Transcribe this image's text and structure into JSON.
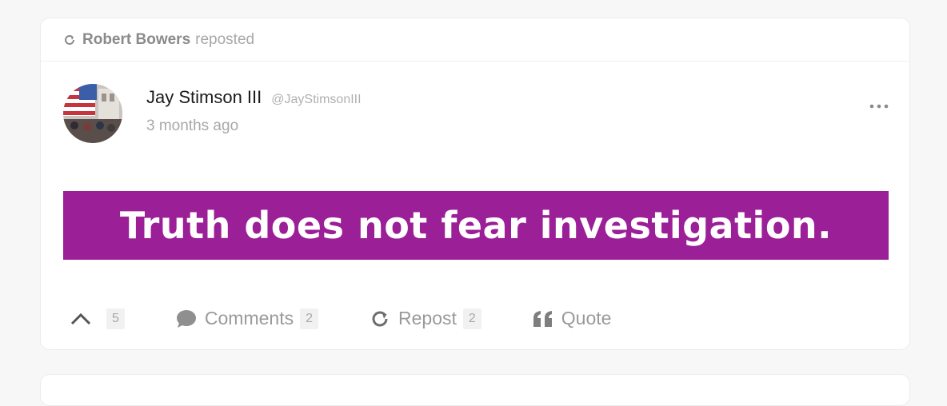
{
  "repost": {
    "user": "Robert Bowers",
    "verb": "reposted"
  },
  "post": {
    "author_name": "Jay Stimson III",
    "author_handle": "@JayStimsonIII",
    "timestamp": "3 months ago",
    "banner_text": "Truth does not fear investigation.",
    "banner_color": "#9b1f97"
  },
  "actions": {
    "upvote_count": "5",
    "comments_label": "Comments",
    "comments_count": "2",
    "repost_label": "Repost",
    "repost_count": "2",
    "quote_label": "Quote"
  },
  "icons": {
    "repost": "repost-icon",
    "upvote": "chevron-up-icon",
    "comment": "speech-bubble-icon",
    "quote": "quote-icon",
    "more": "ellipsis-icon"
  }
}
